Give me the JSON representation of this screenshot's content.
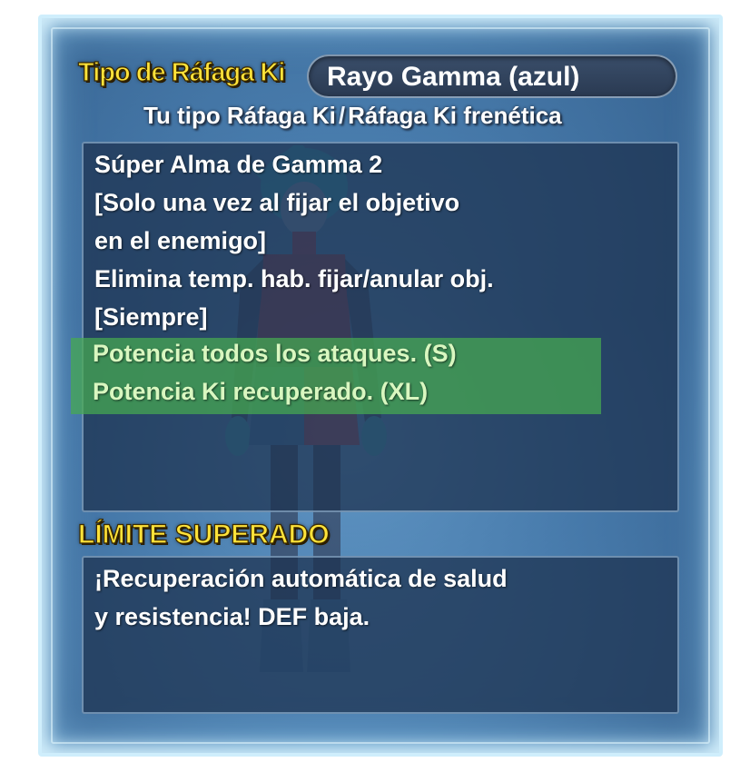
{
  "header": {
    "type_label": "Tipo de Ráfaga Ki",
    "type_value": "Rayo Gamma (azul)",
    "subtitle_left": "Tu tipo Ráfaga Ki",
    "subtitle_separator": "/",
    "subtitle_right": "Ráfaga Ki frenética"
  },
  "description": {
    "lines": [
      "Súper Alma de Gamma 2",
      "[Solo una vez al fijar el objetivo",
      "en el enemigo]",
      "Elimina temp. hab. fijar/anular obj.",
      "[Siempre]"
    ],
    "highlighted_lines": [
      "Potencia todos los ataques. (S)",
      "Potencia Ki recuperado. (XL)"
    ]
  },
  "limit": {
    "label": "LÍMITE SUPERADO",
    "lines": [
      "¡Recuperación automática de salud",
      "y resistencia! DEF baja."
    ]
  },
  "colors": {
    "accent_yellow": "#ffe33a",
    "highlight_green": "#46aa50",
    "frame_glow": "#cfeefc",
    "panel_dark": "#1c304e"
  }
}
